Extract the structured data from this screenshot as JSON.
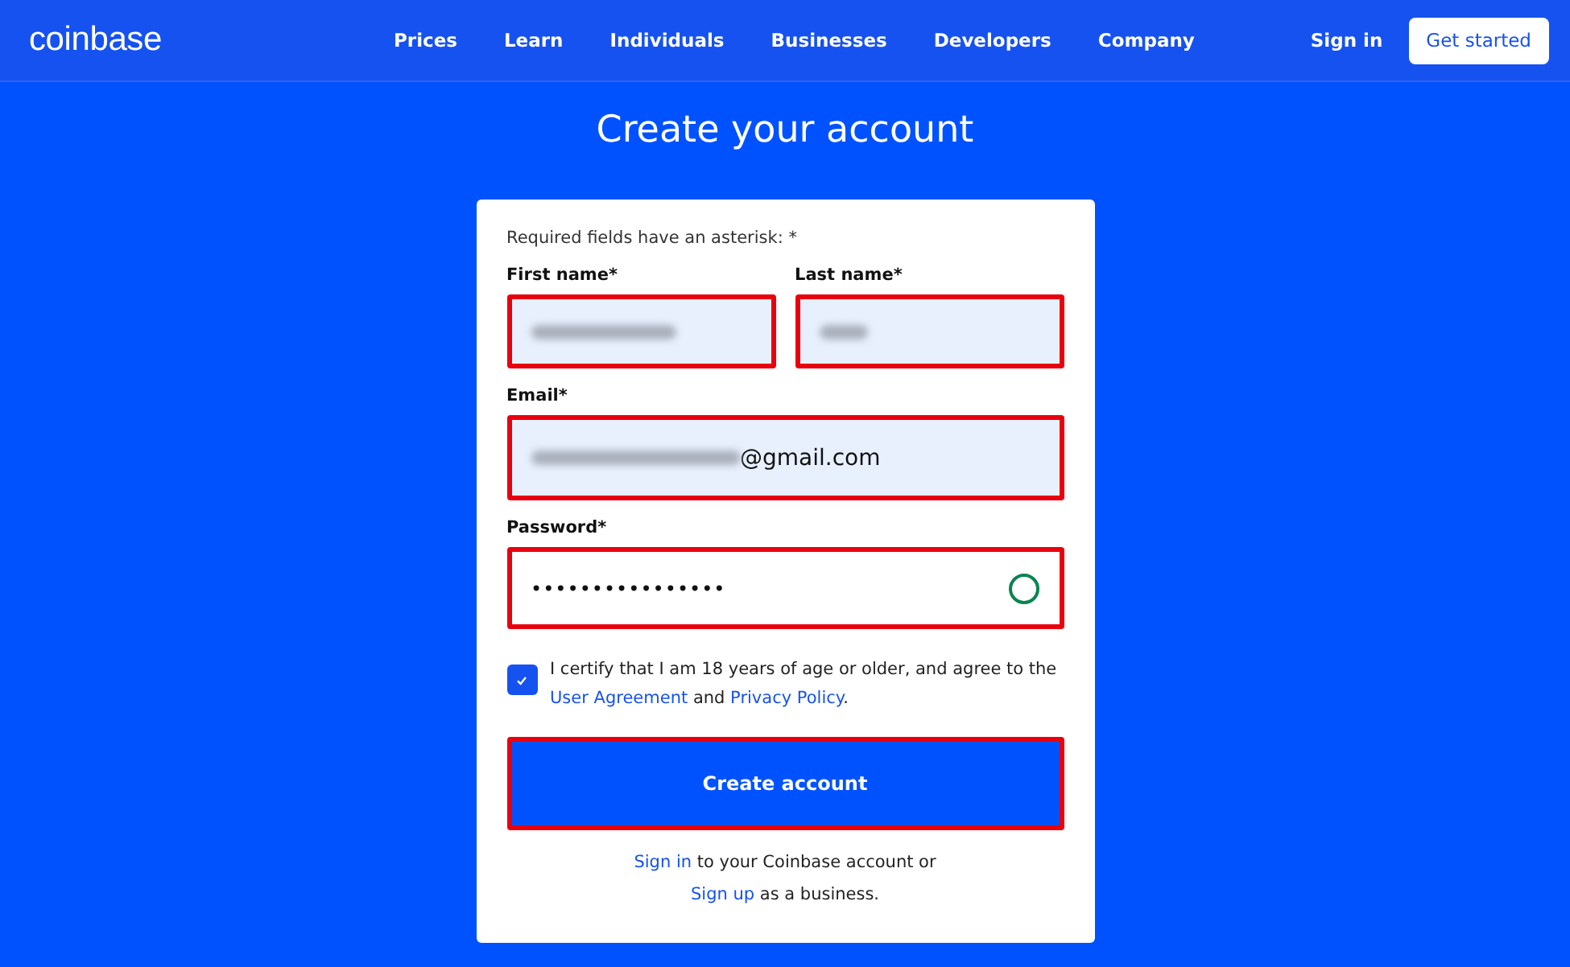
{
  "header": {
    "logo": "coinbase",
    "nav": [
      "Prices",
      "Learn",
      "Individuals",
      "Businesses",
      "Developers",
      "Company"
    ],
    "sign_in": "Sign in",
    "get_started": "Get started"
  },
  "title": "Create your account",
  "form": {
    "note": "Required fields have an asterisk: *",
    "fields": [
      {
        "kind": "half",
        "label": "First name*",
        "redacted": true,
        "highlighted": true,
        "filled": true
      },
      {
        "kind": "half",
        "label": "Last name*",
        "redacted": true,
        "highlighted": true,
        "filled": true
      },
      {
        "kind": "full",
        "label": "Email*",
        "redacted": true,
        "value": "@gmail.com",
        "highlighted": true,
        "filled": true
      },
      {
        "kind": "password",
        "label": "Password*",
        "value": "••••••••••••••••",
        "highlighted": true,
        "filled": false,
        "valid": true
      }
    ],
    "agreement": {
      "checked": true,
      "text": "I certify that I am 18 years of age or older, and agree to the",
      "link1": "User Agreement",
      "and": "and",
      "link2": "Privacy Policy",
      "end": "."
    },
    "submit": {
      "label": "Create account",
      "highlighted": true
    },
    "footer": [
      {
        "link": "Sign in",
        "text": "to your Coinbase account or"
      },
      {
        "link": "Sign up",
        "text": "as a business."
      }
    ]
  }
}
